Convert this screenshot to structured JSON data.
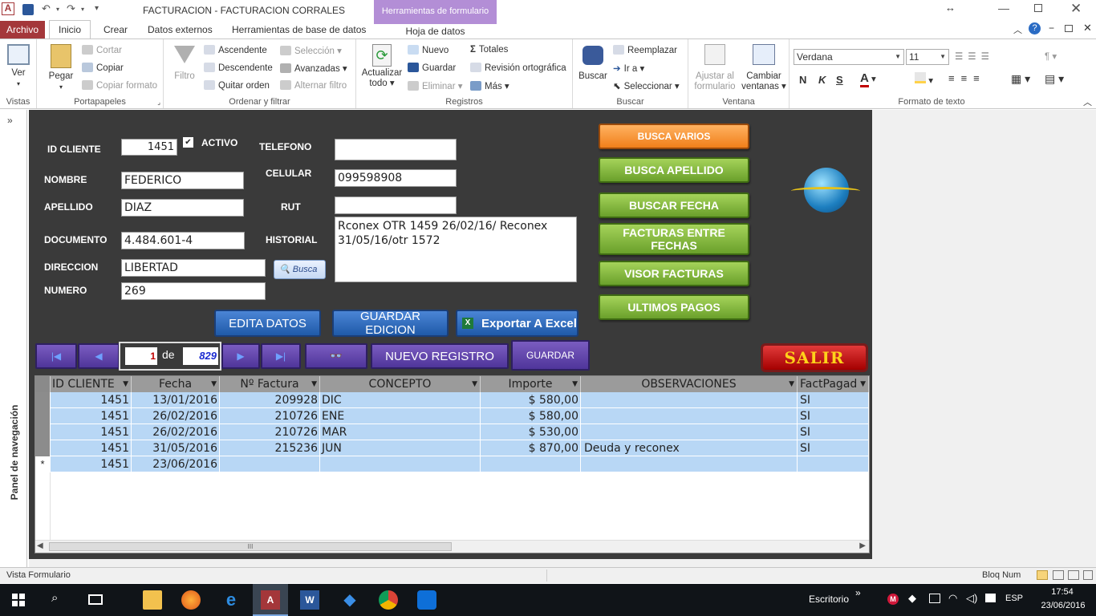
{
  "titlebar": {
    "app_icon": "A",
    "title": "FACTURACION  -  FACTURACION CORRALES",
    "contextual_tab_group": "Herramientas de formulario",
    "contextual_tab": "Hoja de datos",
    "window_controls": [
      "help-icon",
      "minimize-icon",
      "restore-icon",
      "close-icon"
    ]
  },
  "tabs": [
    "Archivo",
    "Inicio",
    "Crear",
    "Datos externos",
    "Herramientas de base de datos"
  ],
  "ribbon": {
    "vistas": {
      "label": "Vistas",
      "ver": "Ver"
    },
    "portapapeles": {
      "label": "Portapapeles",
      "pegar": "Pegar",
      "cortar": "Cortar",
      "copiar": "Copiar",
      "copiar_formato": "Copiar formato"
    },
    "ordenar": {
      "label": "Ordenar y filtrar",
      "filtro": "Filtro",
      "ascendente": "Ascendente",
      "descendente": "Descendente",
      "quitar_orden": "Quitar orden",
      "seleccion": "Selección",
      "avanzadas": "Avanzadas",
      "alternar_filtro": "Alternar filtro"
    },
    "registros": {
      "label": "Registros",
      "actualizar1": "Actualizar",
      "actualizar2": "todo",
      "nuevo": "Nuevo",
      "guardar": "Guardar",
      "eliminar": "Eliminar",
      "totales": "Totales",
      "revision": "Revisión ortográfica",
      "mas": "Más"
    },
    "buscar": {
      "label": "Buscar",
      "buscar": "Buscar",
      "reemplazar": "Reemplazar",
      "ira": "Ir a",
      "seleccionar": "Seleccionar"
    },
    "ventana": {
      "label": "Ventana",
      "ajustar1": "Ajustar al",
      "ajustar2": "formulario",
      "cambiar1": "Cambiar",
      "cambiar2": "ventanas"
    },
    "formato": {
      "label": "Formato de texto",
      "font": "Verdana",
      "size": "11",
      "bold": "N",
      "italic": "K",
      "underline": "S",
      "font_color": "A"
    }
  },
  "navpane": {
    "label": "Panel de navegación",
    "toggle": "»"
  },
  "form": {
    "labels": {
      "id_cliente": "ID CLIENTE",
      "activo": "ACTIVO",
      "telefono": "TELEFONO",
      "nombre": "NOMBRE",
      "celular": "CELULAR",
      "apellido": "APELLIDO",
      "rut": "RUT",
      "documento": "DOCUMENTO",
      "historial": "HISTORIAL",
      "direccion": "DIRECCION",
      "numero": "NUMERO"
    },
    "values": {
      "id_cliente": "1451",
      "activo_checked": "✔",
      "telefono": "",
      "nombre": "FEDERICO",
      "celular": "099598908",
      "apellido": "DIAZ",
      "rut": "",
      "documento": "4.484.601-4",
      "historial": "Rconex OTR 1459 26/02/16/ Reconex 31/05/16/otr 1572",
      "direccion": "LIBERTAD",
      "numero": "269"
    },
    "busca_small": "Busca",
    "buttons": {
      "busca_varios": "BUSCA VARIOS",
      "busca_apellido": "BUSCA APELLIDO",
      "buscar_fecha": "BUSCAR FECHA",
      "facturas_entre": "FACTURAS ENTRE FECHAS",
      "visor_facturas": "VISOR FACTURAS",
      "ultimos_pagos": "ULTIMOS PAGOS",
      "edita_datos": "EDITA DATOS",
      "guardar_edicion": "GUARDAR EDICION",
      "exportar": "Exportar A Excel",
      "nuevo_registro": "NUEVO REGISTRO",
      "guardar": "GUARDAR",
      "salir": "SALIR"
    },
    "record_nav": {
      "current": "1",
      "de": "de",
      "total": "829"
    }
  },
  "grid": {
    "columns": [
      "ID CLIENTE",
      "Fecha",
      "Nº Factura",
      "CONCEPTO",
      "Importe",
      "OBSERVACIONES",
      "FactPagad"
    ],
    "rows": [
      {
        "id": "1451",
        "fecha": "13/01/2016",
        "factura": "209928",
        "concepto": "DIC",
        "importe": "$ 580,00",
        "obs": "",
        "pagada": "SI"
      },
      {
        "id": "1451",
        "fecha": "26/02/2016",
        "factura": "210726",
        "concepto": "ENE",
        "importe": "$ 580,00",
        "obs": "",
        "pagada": "SI"
      },
      {
        "id": "1451",
        "fecha": "26/02/2016",
        "factura": "210726",
        "concepto": "MAR",
        "importe": "$ 530,00",
        "obs": "",
        "pagada": "SI"
      },
      {
        "id": "1451",
        "fecha": "31/05/2016",
        "factura": "215236",
        "concepto": "JUN",
        "importe": "$ 870,00",
        "obs": "Deuda y reconex",
        "pagada": "SI"
      },
      {
        "id": "1451",
        "fecha": "23/06/2016",
        "factura": "",
        "concepto": "",
        "importe": "",
        "obs": "",
        "pagada": "",
        "new": "*"
      }
    ],
    "hscroll_mark": "III"
  },
  "status": {
    "left": "Vista Formulario",
    "right": "Bloq Num"
  },
  "taskbar": {
    "escritorio": "Escritorio",
    "lang": "ESP",
    "time": "17:54",
    "date": "23/06/2016"
  },
  "colors": {
    "access_red": "#a4373a",
    "form_bg": "#3a3a3a",
    "green_btn": "#7db23a",
    "blue_btn": "#2a65b5",
    "purple_btn": "#5c40a6",
    "row_blue": "#b8d7f5"
  }
}
